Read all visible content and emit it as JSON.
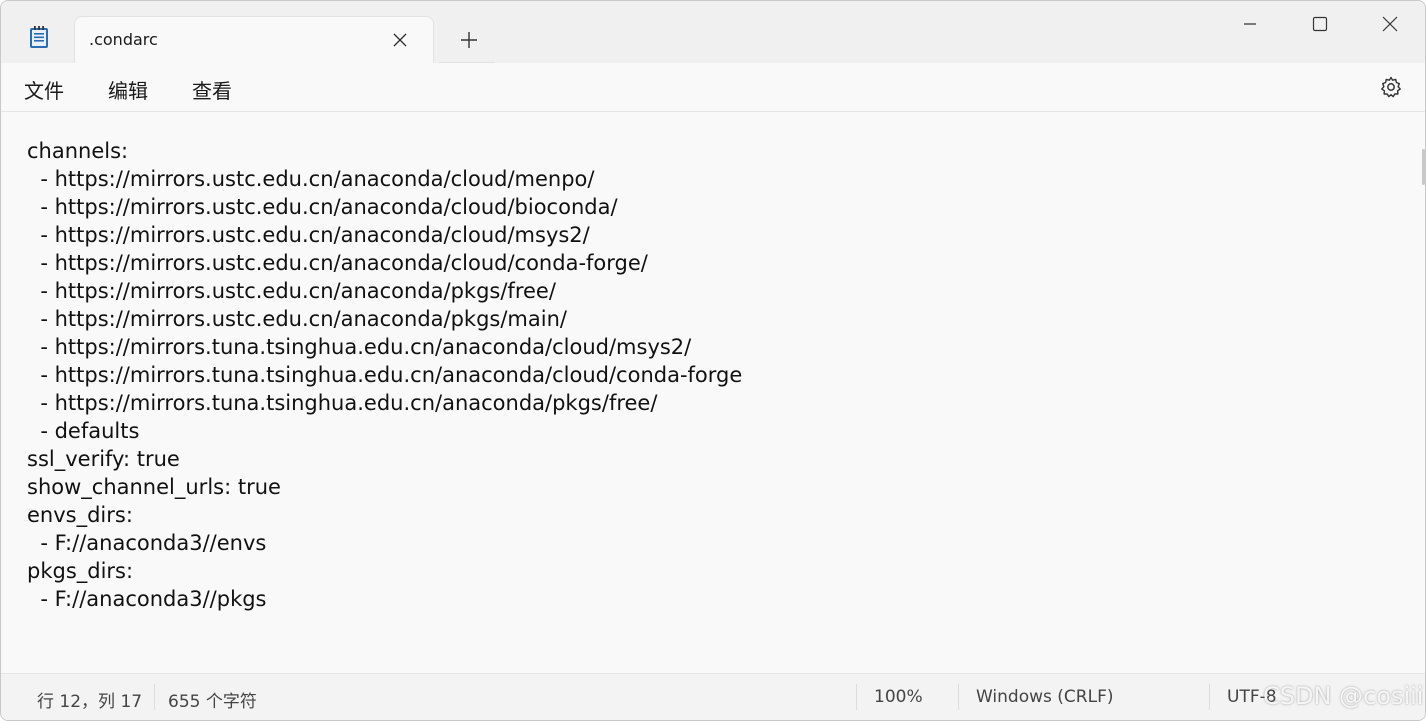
{
  "window": {
    "tab_title": ".condarc",
    "app_icon": "notepad-icon",
    "controls": [
      "minimize-icon",
      "maximize-icon",
      "close-icon"
    ]
  },
  "menu": {
    "file": "文件",
    "edit": "编辑",
    "view": "查看",
    "settings_icon": "gear-icon"
  },
  "editor": {
    "lines": [
      "channels:",
      "  - https://mirrors.ustc.edu.cn/anaconda/cloud/menpo/",
      "  - https://mirrors.ustc.edu.cn/anaconda/cloud/bioconda/",
      "  - https://mirrors.ustc.edu.cn/anaconda/cloud/msys2/",
      "  - https://mirrors.ustc.edu.cn/anaconda/cloud/conda-forge/",
      "  - https://mirrors.ustc.edu.cn/anaconda/pkgs/free/",
      "  - https://mirrors.ustc.edu.cn/anaconda/pkgs/main/",
      "  - https://mirrors.tuna.tsinghua.edu.cn/anaconda/cloud/msys2/",
      "  - https://mirrors.tuna.tsinghua.edu.cn/anaconda/cloud/conda-forge",
      "  - https://mirrors.tuna.tsinghua.edu.cn/anaconda/pkgs/free/",
      "  - defaults",
      "ssl_verify: true",
      "show_channel_urls: true",
      "envs_dirs:",
      "  - F://anaconda3//envs",
      "pkgs_dirs:",
      "  - F://anaconda3//pkgs"
    ]
  },
  "status": {
    "position": "行 12，列 17",
    "char_count": "655 个字符",
    "zoom": "100%",
    "line_ending": "Windows (CRLF)",
    "encoding": "UTF-8"
  },
  "watermark": "CSDN @cosiii"
}
